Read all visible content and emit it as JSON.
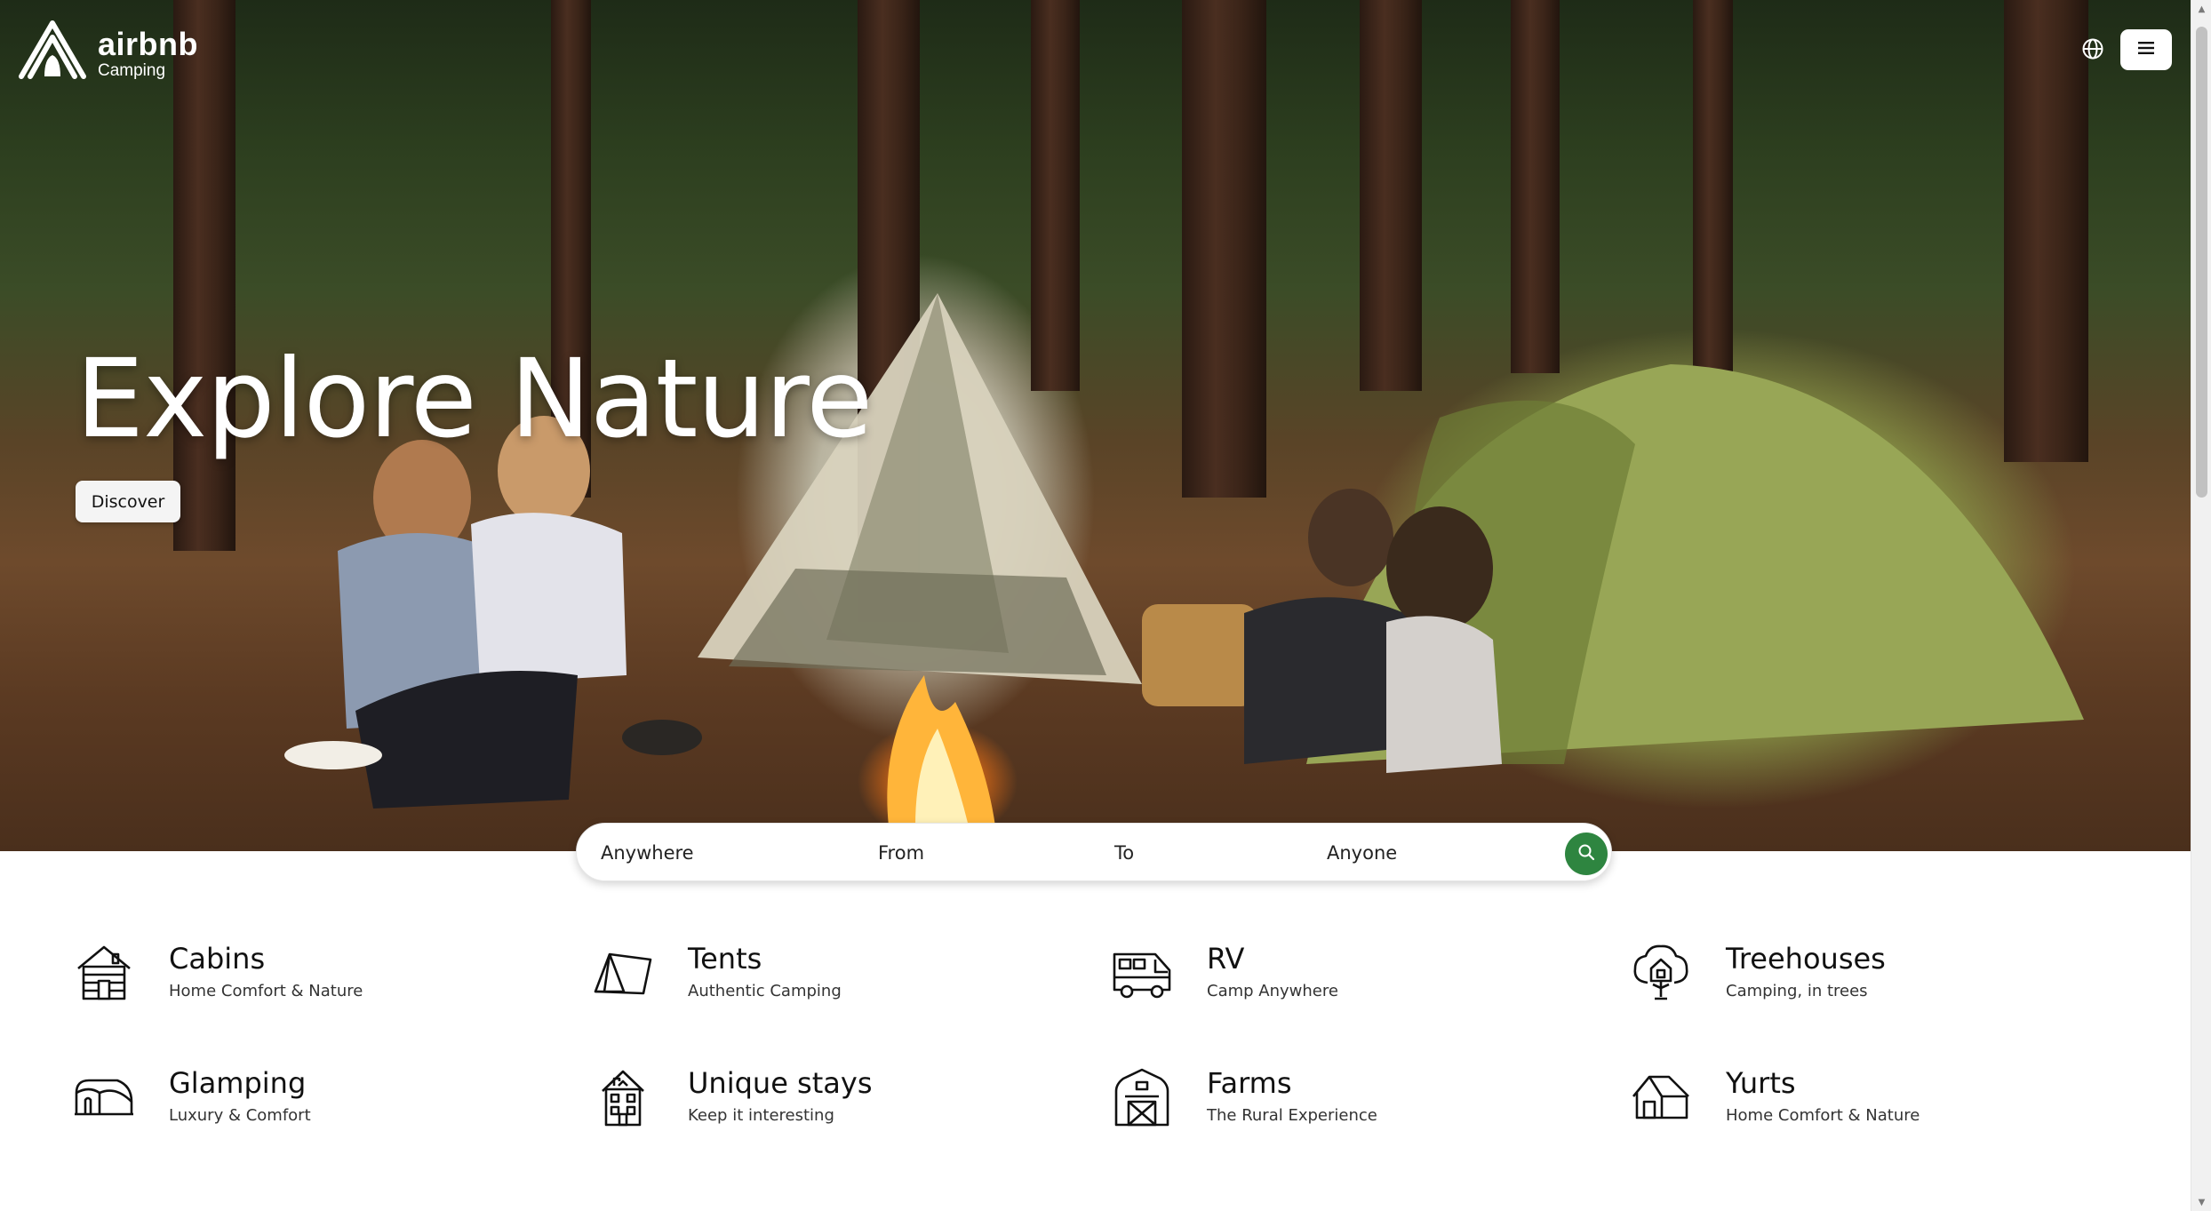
{
  "brand": {
    "name": "airbnb",
    "tagline": "Camping"
  },
  "header": {
    "language_icon": "globe-icon",
    "menu_icon": "hamburger-menu-icon"
  },
  "hero": {
    "title": "Explore Nature",
    "cta_label": "Discover"
  },
  "search": {
    "location": "Anywhere",
    "from": "From",
    "to": "To",
    "guests": "Anyone",
    "button_icon": "search-icon",
    "button_color": "#2e8540"
  },
  "categories": [
    {
      "title": "Cabins",
      "subtitle": "Home Comfort & Nature",
      "icon": "cabin-icon"
    },
    {
      "title": "Tents",
      "subtitle": "Authentic Camping",
      "icon": "tent-icon"
    },
    {
      "title": "RV",
      "subtitle": "Camp Anywhere",
      "icon": "rv-icon"
    },
    {
      "title": "Treehouses",
      "subtitle": "Camping, in trees",
      "icon": "treehouse-icon"
    },
    {
      "title": "Glamping",
      "subtitle": "Luxury & Comfort",
      "icon": "glamping-icon"
    },
    {
      "title": "Unique stays",
      "subtitle": "Keep it interesting",
      "icon": "unique-stays-icon"
    },
    {
      "title": "Farms",
      "subtitle": "The Rural Experience",
      "icon": "barn-icon"
    },
    {
      "title": "Yurts",
      "subtitle": "Home Comfort & Nature",
      "icon": "yurt-icon"
    }
  ]
}
